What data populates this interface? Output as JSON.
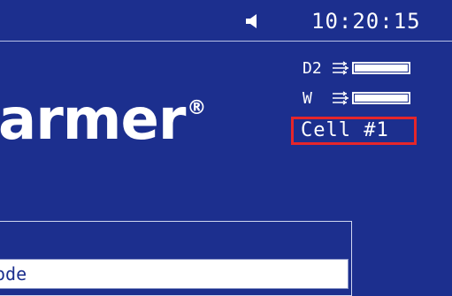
{
  "status_bar": {
    "clock": "10:20:15",
    "speaker_icon": "speaker-icon"
  },
  "logo": {
    "text": "armer",
    "registered_mark": "®"
  },
  "lamps": [
    {
      "name": "D2",
      "icon": "light-rays-icon",
      "level": 1.0
    },
    {
      "name": "W",
      "icon": "light-rays-icon",
      "level": 1.0
    }
  ],
  "cell_label": "Cell #1",
  "panel": {
    "mode_text": "ode"
  },
  "colors": {
    "background": "#1c2f8e",
    "highlight": "#e5262a",
    "text": "#ffffff"
  }
}
